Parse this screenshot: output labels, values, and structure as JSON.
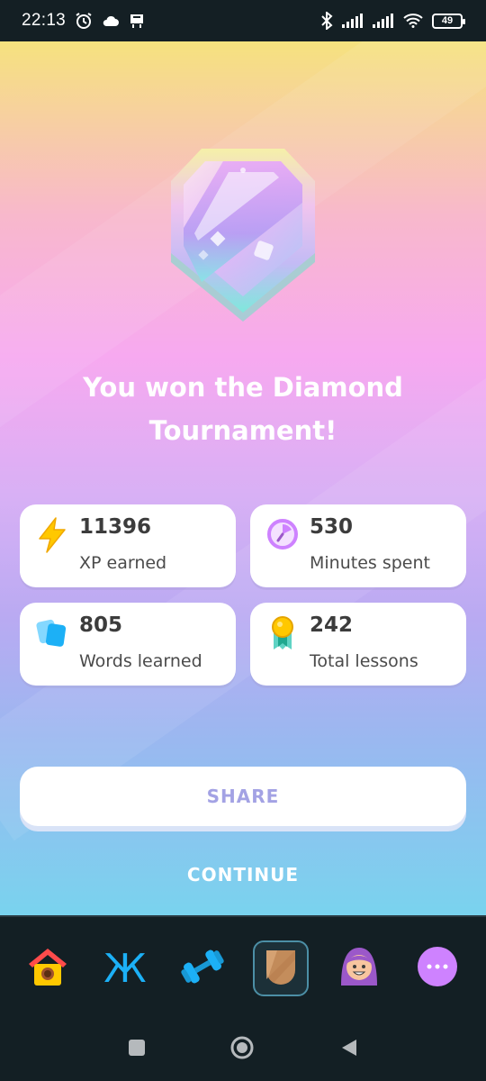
{
  "status_bar": {
    "time": "22:13",
    "battery": "49",
    "icons": [
      "alarm-icon",
      "cloud-icon",
      "notification-icon",
      "bluetooth-icon",
      "signal-icon",
      "signal-icon",
      "wifi-icon",
      "battery-icon"
    ]
  },
  "result": {
    "title_line1": "You won the Diamond",
    "title_line2": "Tournament!",
    "badge": "diamond-league-badge"
  },
  "stats": [
    {
      "value": "11396",
      "label": "XP earned",
      "icon": "lightning-icon",
      "color": "#ffc800"
    },
    {
      "value": "530",
      "label": "Minutes spent",
      "icon": "clock-icon",
      "color": "#ce82ff"
    },
    {
      "value": "805",
      "label": "Words learned",
      "icon": "cards-icon",
      "color": "#1cb0f6"
    },
    {
      "value": "242",
      "label": "Total lessons",
      "icon": "medal-icon",
      "color": "#ffc800"
    }
  ],
  "buttons": {
    "share": "SHARE",
    "continue": "CONTINUE"
  },
  "tabs": [
    {
      "name": "home",
      "icon": "home-icon"
    },
    {
      "name": "letters",
      "icon": "cyrillic-zhe-icon",
      "glyph": "Ж"
    },
    {
      "name": "practice",
      "icon": "dumbbell-icon"
    },
    {
      "name": "leaderboard",
      "icon": "shield-icon",
      "active": true
    },
    {
      "name": "profile",
      "icon": "avatar-icon"
    },
    {
      "name": "more",
      "icon": "more-icon"
    }
  ],
  "colors": {
    "accent_share_text": "#a3a2e4",
    "tab_active_border": "#4c8fa6",
    "background_dark": "#131f24"
  }
}
